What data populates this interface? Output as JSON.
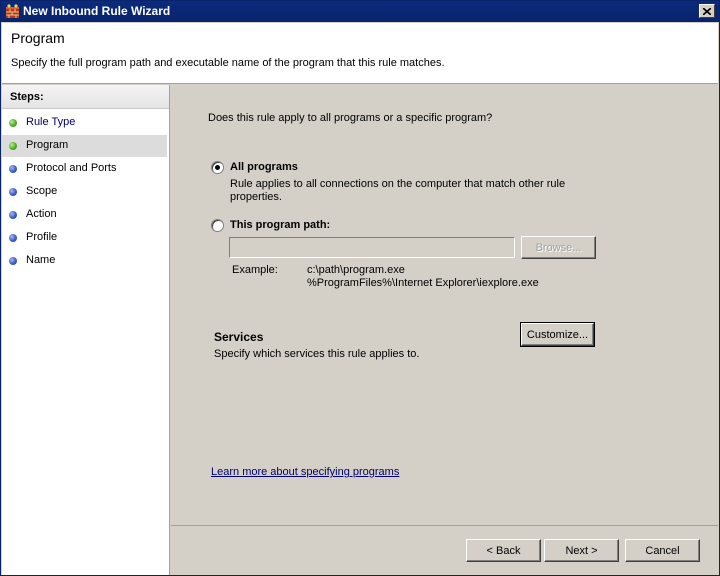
{
  "window": {
    "title": "New Inbound Rule Wizard",
    "app_icon": "firewall-icon",
    "close_icon": "close-icon"
  },
  "header": {
    "title": "Program",
    "subtitle": "Specify the full program path and executable name of the program that this rule matches."
  },
  "steps": {
    "heading": "Steps:",
    "items": [
      {
        "label": "Rule Type",
        "state": "done",
        "link": true
      },
      {
        "label": "Program",
        "state": "current",
        "link": false
      },
      {
        "label": "Protocol and Ports",
        "state": "pending",
        "link": false
      },
      {
        "label": "Scope",
        "state": "pending",
        "link": false
      },
      {
        "label": "Action",
        "state": "pending",
        "link": false
      },
      {
        "label": "Profile",
        "state": "pending",
        "link": false
      },
      {
        "label": "Name",
        "state": "pending",
        "link": false
      }
    ]
  },
  "main": {
    "question": "Does this rule apply to all programs or a specific program?",
    "all_programs": {
      "label": "All programs",
      "description": "Rule applies to all connections on the computer that match other rule properties.",
      "checked": true
    },
    "program_path": {
      "label": "This program path:",
      "value": "",
      "checked": false,
      "browse_label": "Browse..."
    },
    "example": {
      "label": "Example:",
      "line1": "c:\\path\\program.exe",
      "line2": "%ProgramFiles%\\Internet Explorer\\iexplore.exe"
    },
    "services": {
      "title": "Services",
      "description": "Specify which services this rule applies to.",
      "button": "Customize..."
    },
    "learn_more": "Learn more about specifying programs"
  },
  "footer": {
    "back": "< Back",
    "next": "Next >",
    "cancel": "Cancel"
  },
  "colors": {
    "titlebar": "#0a246a",
    "face": "#d4d0c8",
    "link": "#00006e",
    "done_dot": "#4cb02a",
    "pending_dot": "#3c5ac8"
  }
}
